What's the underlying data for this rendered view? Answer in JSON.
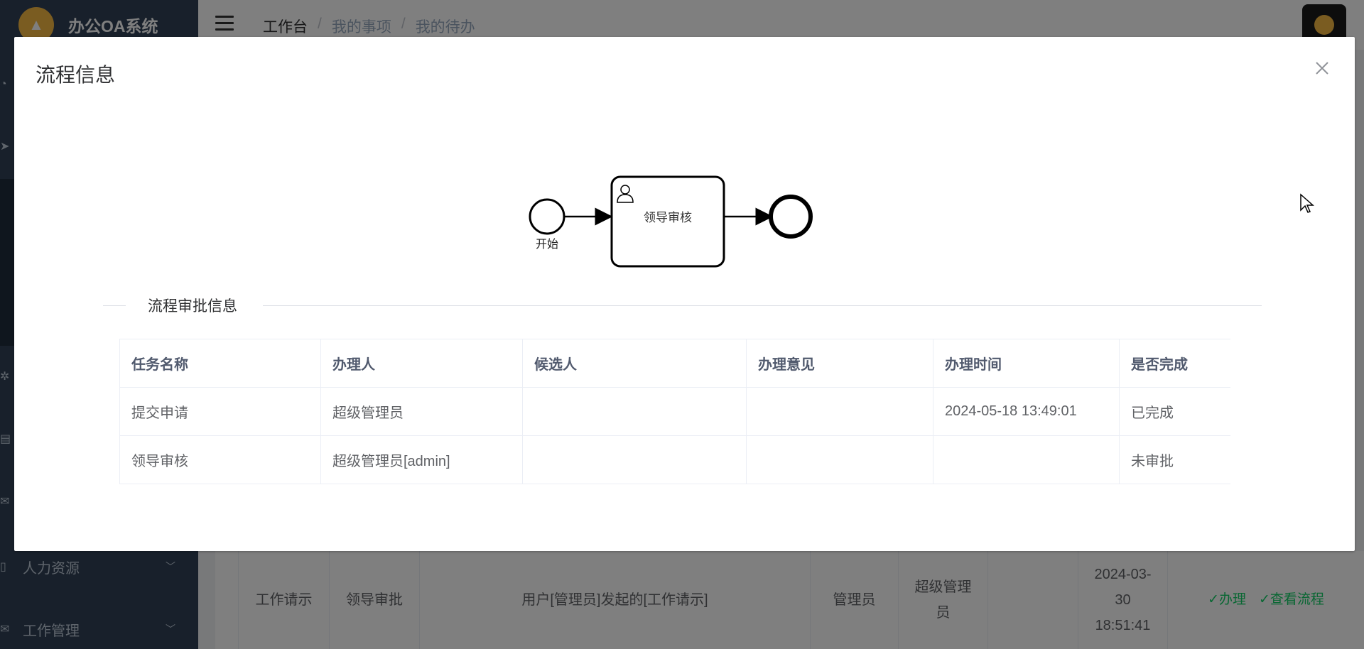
{
  "app": {
    "title": "办公OA系统"
  },
  "sidebar": {
    "items": [
      {
        "label": "人力资源",
        "icon": "book-icon"
      },
      {
        "label": "工作管理",
        "icon": "mail-icon"
      }
    ]
  },
  "navbar": {
    "breadcrumb": [
      "工作台",
      "我的事项",
      "我的待办"
    ],
    "separator": "/"
  },
  "background_table": {
    "row": {
      "type": "工作请示",
      "node": "领导审批",
      "title": "用户[管理员]发起的[工作请示]",
      "applicant": "管理员",
      "handler": "超级管理员",
      "time": "2024-03-30 18:51:41",
      "action_handle": "✓办理",
      "action_view": "✓查看流程"
    }
  },
  "dialog": {
    "title": "流程信息",
    "close_icon": "close-icon",
    "diagram": {
      "start_label": "开始",
      "task_label": "领导审核",
      "task_icon": "user-icon"
    },
    "section_title": "流程审批信息",
    "table": {
      "headers": [
        "任务名称",
        "办理人",
        "候选人",
        "办理意见",
        "办理时间",
        "是否完成"
      ],
      "rows": [
        [
          "提交申请",
          "超级管理员",
          "",
          "",
          "2024-05-18 13:49:01",
          "已完成"
        ],
        [
          "领导审核",
          "超级管理员[admin]",
          "",
          "",
          "",
          "未审批"
        ]
      ]
    }
  },
  "colors": {
    "sidebar": "#304156",
    "accent_green": "#13ce66",
    "logo": "#f5b942"
  }
}
